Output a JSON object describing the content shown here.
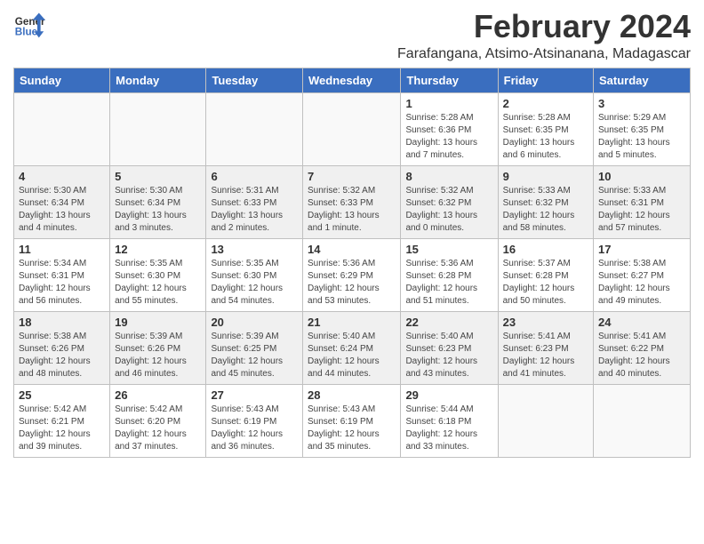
{
  "app": {
    "logo_line1": "General",
    "logo_line2": "Blue"
  },
  "header": {
    "title": "February 2024",
    "subtitle": "Farafangana, Atsimo-Atsinanana, Madagascar"
  },
  "weekdays": [
    "Sunday",
    "Monday",
    "Tuesday",
    "Wednesday",
    "Thursday",
    "Friday",
    "Saturday"
  ],
  "weeks": [
    [
      {
        "day": "",
        "info": ""
      },
      {
        "day": "",
        "info": ""
      },
      {
        "day": "",
        "info": ""
      },
      {
        "day": "",
        "info": ""
      },
      {
        "day": "1",
        "info": "Sunrise: 5:28 AM\nSunset: 6:36 PM\nDaylight: 13 hours\nand 7 minutes."
      },
      {
        "day": "2",
        "info": "Sunrise: 5:28 AM\nSunset: 6:35 PM\nDaylight: 13 hours\nand 6 minutes."
      },
      {
        "day": "3",
        "info": "Sunrise: 5:29 AM\nSunset: 6:35 PM\nDaylight: 13 hours\nand 5 minutes."
      }
    ],
    [
      {
        "day": "4",
        "info": "Sunrise: 5:30 AM\nSunset: 6:34 PM\nDaylight: 13 hours\nand 4 minutes."
      },
      {
        "day": "5",
        "info": "Sunrise: 5:30 AM\nSunset: 6:34 PM\nDaylight: 13 hours\nand 3 minutes."
      },
      {
        "day": "6",
        "info": "Sunrise: 5:31 AM\nSunset: 6:33 PM\nDaylight: 13 hours\nand 2 minutes."
      },
      {
        "day": "7",
        "info": "Sunrise: 5:32 AM\nSunset: 6:33 PM\nDaylight: 13 hours\nand 1 minute."
      },
      {
        "day": "8",
        "info": "Sunrise: 5:32 AM\nSunset: 6:32 PM\nDaylight: 13 hours\nand 0 minutes."
      },
      {
        "day": "9",
        "info": "Sunrise: 5:33 AM\nSunset: 6:32 PM\nDaylight: 12 hours\nand 58 minutes."
      },
      {
        "day": "10",
        "info": "Sunrise: 5:33 AM\nSunset: 6:31 PM\nDaylight: 12 hours\nand 57 minutes."
      }
    ],
    [
      {
        "day": "11",
        "info": "Sunrise: 5:34 AM\nSunset: 6:31 PM\nDaylight: 12 hours\nand 56 minutes."
      },
      {
        "day": "12",
        "info": "Sunrise: 5:35 AM\nSunset: 6:30 PM\nDaylight: 12 hours\nand 55 minutes."
      },
      {
        "day": "13",
        "info": "Sunrise: 5:35 AM\nSunset: 6:30 PM\nDaylight: 12 hours\nand 54 minutes."
      },
      {
        "day": "14",
        "info": "Sunrise: 5:36 AM\nSunset: 6:29 PM\nDaylight: 12 hours\nand 53 minutes."
      },
      {
        "day": "15",
        "info": "Sunrise: 5:36 AM\nSunset: 6:28 PM\nDaylight: 12 hours\nand 51 minutes."
      },
      {
        "day": "16",
        "info": "Sunrise: 5:37 AM\nSunset: 6:28 PM\nDaylight: 12 hours\nand 50 minutes."
      },
      {
        "day": "17",
        "info": "Sunrise: 5:38 AM\nSunset: 6:27 PM\nDaylight: 12 hours\nand 49 minutes."
      }
    ],
    [
      {
        "day": "18",
        "info": "Sunrise: 5:38 AM\nSunset: 6:26 PM\nDaylight: 12 hours\nand 48 minutes."
      },
      {
        "day": "19",
        "info": "Sunrise: 5:39 AM\nSunset: 6:26 PM\nDaylight: 12 hours\nand 46 minutes."
      },
      {
        "day": "20",
        "info": "Sunrise: 5:39 AM\nSunset: 6:25 PM\nDaylight: 12 hours\nand 45 minutes."
      },
      {
        "day": "21",
        "info": "Sunrise: 5:40 AM\nSunset: 6:24 PM\nDaylight: 12 hours\nand 44 minutes."
      },
      {
        "day": "22",
        "info": "Sunrise: 5:40 AM\nSunset: 6:23 PM\nDaylight: 12 hours\nand 43 minutes."
      },
      {
        "day": "23",
        "info": "Sunrise: 5:41 AM\nSunset: 6:23 PM\nDaylight: 12 hours\nand 41 minutes."
      },
      {
        "day": "24",
        "info": "Sunrise: 5:41 AM\nSunset: 6:22 PM\nDaylight: 12 hours\nand 40 minutes."
      }
    ],
    [
      {
        "day": "25",
        "info": "Sunrise: 5:42 AM\nSunset: 6:21 PM\nDaylight: 12 hours\nand 39 minutes."
      },
      {
        "day": "26",
        "info": "Sunrise: 5:42 AM\nSunset: 6:20 PM\nDaylight: 12 hours\nand 37 minutes."
      },
      {
        "day": "27",
        "info": "Sunrise: 5:43 AM\nSunset: 6:19 PM\nDaylight: 12 hours\nand 36 minutes."
      },
      {
        "day": "28",
        "info": "Sunrise: 5:43 AM\nSunset: 6:19 PM\nDaylight: 12 hours\nand 35 minutes."
      },
      {
        "day": "29",
        "info": "Sunrise: 5:44 AM\nSunset: 6:18 PM\nDaylight: 12 hours\nand 33 minutes."
      },
      {
        "day": "",
        "info": ""
      },
      {
        "day": "",
        "info": ""
      }
    ]
  ]
}
